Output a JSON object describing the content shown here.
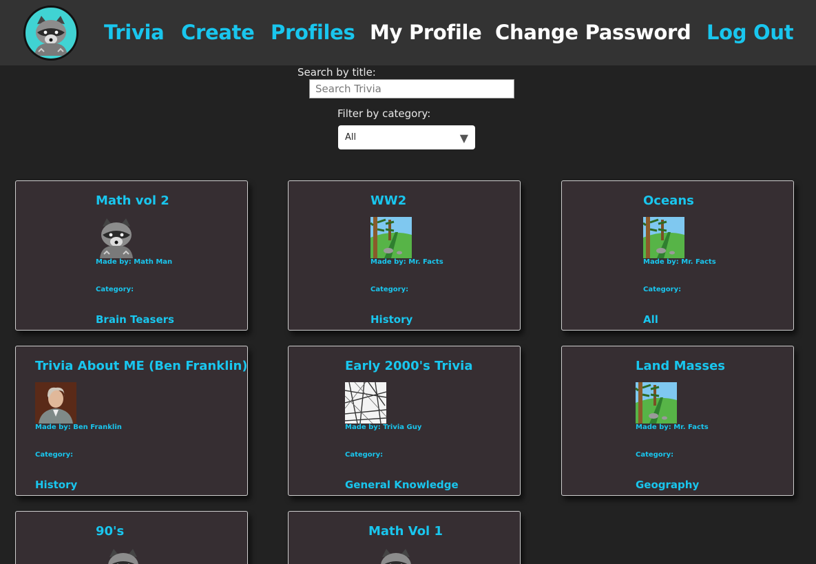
{
  "nav": {
    "logo_icon": "raccoon-logo",
    "links": [
      {
        "label": "Trivia",
        "color": "#19c6ee"
      },
      {
        "label": "Create",
        "color": "#19c6ee"
      },
      {
        "label": "Profiles",
        "color": "#19c6ee"
      },
      {
        "label": "My Profile",
        "color": "#ffffff"
      },
      {
        "label": "Change Password",
        "color": "#ffffff"
      },
      {
        "label": "Log Out",
        "color": "#19c6ee"
      }
    ]
  },
  "search": {
    "label": "Search by title:",
    "placeholder": "Search Trivia",
    "value": ""
  },
  "filter": {
    "label": "Filter by category:",
    "selected": "All",
    "arrow": "▼"
  },
  "cards": [
    {
      "title": "Math vol 2",
      "image": "raccoon",
      "made_by": "Made by: Math Man",
      "category_label": "Category:",
      "category": "Brain Teasers"
    },
    {
      "title": "WW2",
      "image": "landscape",
      "made_by": "Made by: Mr. Facts",
      "category_label": "Category:",
      "category": "History"
    },
    {
      "title": "Oceans",
      "image": "landscape",
      "made_by": "Made by: Mr. Facts",
      "category_label": "Category:",
      "category": "All"
    },
    {
      "title": "Trivia About ME (Ben Franklin)",
      "image": "portrait",
      "made_by": "Made by: Ben Franklin",
      "category_label": "Category:",
      "category": "History"
    },
    {
      "title": "Early 2000's Trivia",
      "image": "street-map",
      "made_by": "Made by: Trivia Guy",
      "category_label": "Category:",
      "category": "General Knowledge"
    },
    {
      "title": "Land Masses",
      "image": "landscape",
      "made_by": "Made by: Mr. Facts",
      "category_label": "Category:",
      "category": "Geography"
    },
    {
      "title": "90's",
      "image": "raccoon",
      "made_by": "",
      "category_label": "",
      "category": ""
    },
    {
      "title": "Math Vol 1",
      "image": "raccoon",
      "made_by": "",
      "category_label": "",
      "category": ""
    }
  ],
  "colors": {
    "accent": "#19c6ee",
    "background": "#222222",
    "navbar": "#333333",
    "card": "#362e32"
  }
}
